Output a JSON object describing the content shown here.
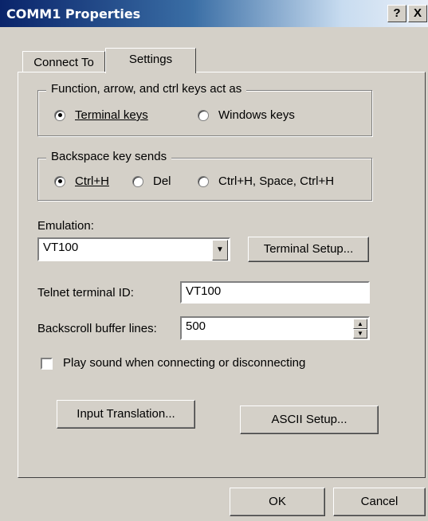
{
  "window": {
    "title": "COMM1 Properties",
    "help_label": "?",
    "close_label": "X"
  },
  "tabs": [
    {
      "label": "Connect To"
    },
    {
      "label": "Settings"
    }
  ],
  "function_keys": {
    "title": "Function, arrow, and ctrl keys act as",
    "options": [
      {
        "label": "Terminal keys",
        "selected": true
      },
      {
        "label": "Windows keys",
        "selected": false
      }
    ]
  },
  "backspace": {
    "title": "Backspace key sends",
    "options": [
      {
        "label": "Ctrl+H",
        "selected": true
      },
      {
        "label": "Del",
        "selected": false
      },
      {
        "label": "Ctrl+H, Space, Ctrl+H",
        "selected": false
      }
    ]
  },
  "emulation": {
    "label": "Emulation:",
    "value": "VT100"
  },
  "terminal_setup_label": "Terminal Setup...",
  "telnet": {
    "label": "Telnet terminal ID:",
    "value": "VT100"
  },
  "backscroll": {
    "label": "Backscroll buffer lines:",
    "value": "500"
  },
  "play_sound": {
    "label": "Play sound when connecting or disconnecting",
    "checked": false
  },
  "input_translation_label": "Input Translation...",
  "ascii_setup_label": "ASCII Setup...",
  "ok_label": "OK",
  "cancel_label": "Cancel"
}
